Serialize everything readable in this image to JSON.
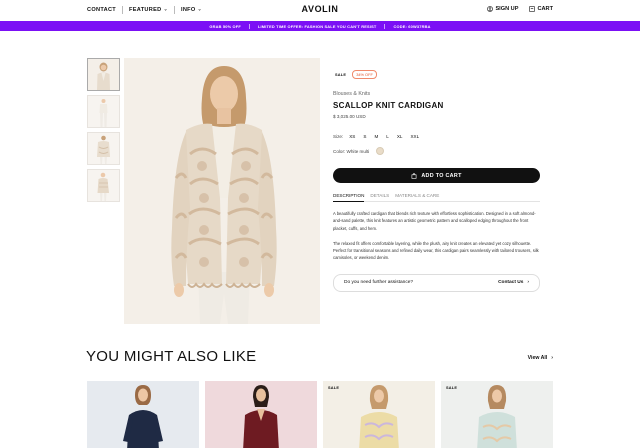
{
  "header": {
    "nav_left": [
      {
        "label": "CONTACT",
        "has_chevron": false
      },
      {
        "label": "FEATURED",
        "has_chevron": true
      },
      {
        "label": "INFO",
        "has_chevron": true
      }
    ],
    "logo": "AVOLIN",
    "sign_up": "SIGN UP",
    "cart": "CART"
  },
  "promo": {
    "items": [
      "GRAB 50% OFF",
      "LIMITED TIME OFFER: FASHION SALE YOU CAN'T RESIST",
      "CODE: 60W37RBA"
    ],
    "background": "#7b10f5"
  },
  "product": {
    "sale_tag": "SALE",
    "discount_tag": "34% OFF",
    "category": "Blouses & Knits",
    "title": "SCALLOP KNIT CARDIGAN",
    "price": "$ 3,025.00 USD",
    "size_label": "Size:",
    "sizes": [
      "XS",
      "S",
      "M",
      "L",
      "XL",
      "XXL"
    ],
    "color_label": "Color: White multi",
    "color_swatch": "#e9dcc8",
    "add_to_cart": "ADD TO CART",
    "tabs": [
      "DESCRIPTION",
      "DETAILS",
      "MATERIALS & CARE"
    ],
    "description": [
      "A beautifully crafted cardigan that blends rich texture with effortless sophistication. Designed in a soft almond-and-sand palette, this knit features an artistic geometric pattern and scalloped edging throughout the front placket, cuffs, and hem.",
      "The relaxed fit offers comfortable layering, while the plush, airy knit creates an elevated yet cozy silhouette. Perfect for transitional seasons and refined daily wear, this cardigan pairs seamlessly with tailored trousers, silk camisoles, or weekend denim."
    ],
    "assistance_question": "Do you need further assistance?",
    "contact_link": "Contact Us"
  },
  "recommendations": {
    "title": "YOU MIGHT ALSO LIKE",
    "view_all": "View All",
    "cards": [
      {
        "badge": "",
        "bg": "#e6eaef",
        "garment": "#1f2a44"
      },
      {
        "badge": "",
        "bg": "#efd9dc",
        "garment": "#6e1b22"
      },
      {
        "badge": "SALE",
        "bg": "#f3efe6",
        "garment": "#ecdca6"
      },
      {
        "badge": "SALE",
        "bg": "#eef0ee",
        "garment": "#cfe0db"
      }
    ]
  }
}
